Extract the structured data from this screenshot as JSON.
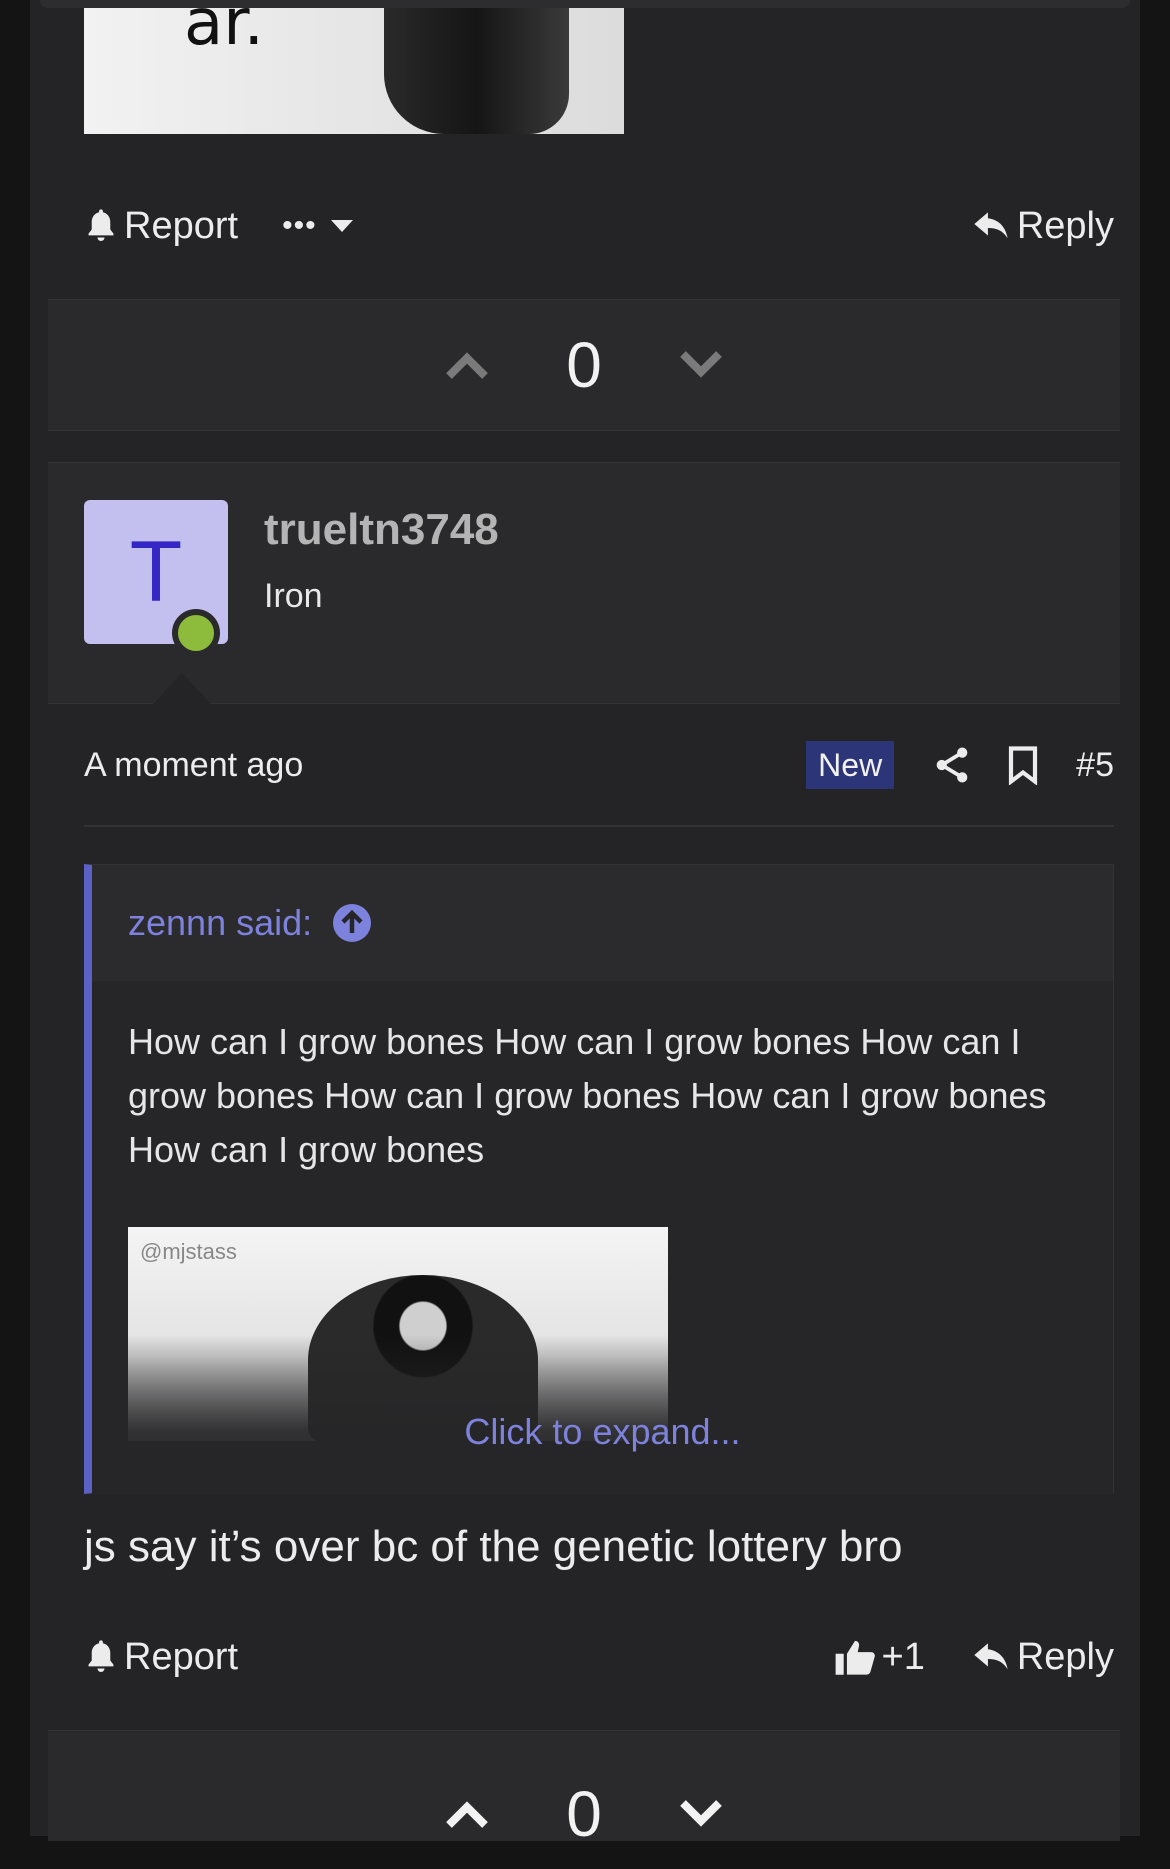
{
  "previous_post": {
    "image_text": "ar.",
    "actions": {
      "report_label": "Report",
      "more_label": "•••",
      "reply_label": "Reply"
    },
    "votes": {
      "count": "0"
    }
  },
  "post": {
    "author": {
      "avatar_letter": "T",
      "username": "trueltn3748",
      "rank": "Iron",
      "avatar_color": "#c3c0f0",
      "online_color": "#8dbb3b"
    },
    "timestamp": "A moment ago",
    "badge_new": "New",
    "post_number": "#5",
    "quote": {
      "author_label": "zennn said:",
      "text": "How can I grow bones How can I grow bones How can I grow bones How can I grow bones How can I grow bones How can I grow bones",
      "image_watermark": "@mjstass",
      "expand_label": "Click to expand..."
    },
    "body": "js say it’s over bc of the genetic lottery bro",
    "actions": {
      "report_label": "Report",
      "like_count": "+1",
      "reply_label": "Reply"
    },
    "votes": {
      "count": "0"
    }
  },
  "colors": {
    "accent": "#5c61c7",
    "link": "#7d82dc",
    "badge_bg": "#2c3577",
    "background": "#242426"
  },
  "icons": [
    "bell-icon",
    "more-icon",
    "chevron-down-icon",
    "reply-icon",
    "upvote-icon",
    "downvote-icon",
    "share-icon",
    "bookmark-icon",
    "arrow-up-circle-icon",
    "thumbs-up-icon"
  ]
}
